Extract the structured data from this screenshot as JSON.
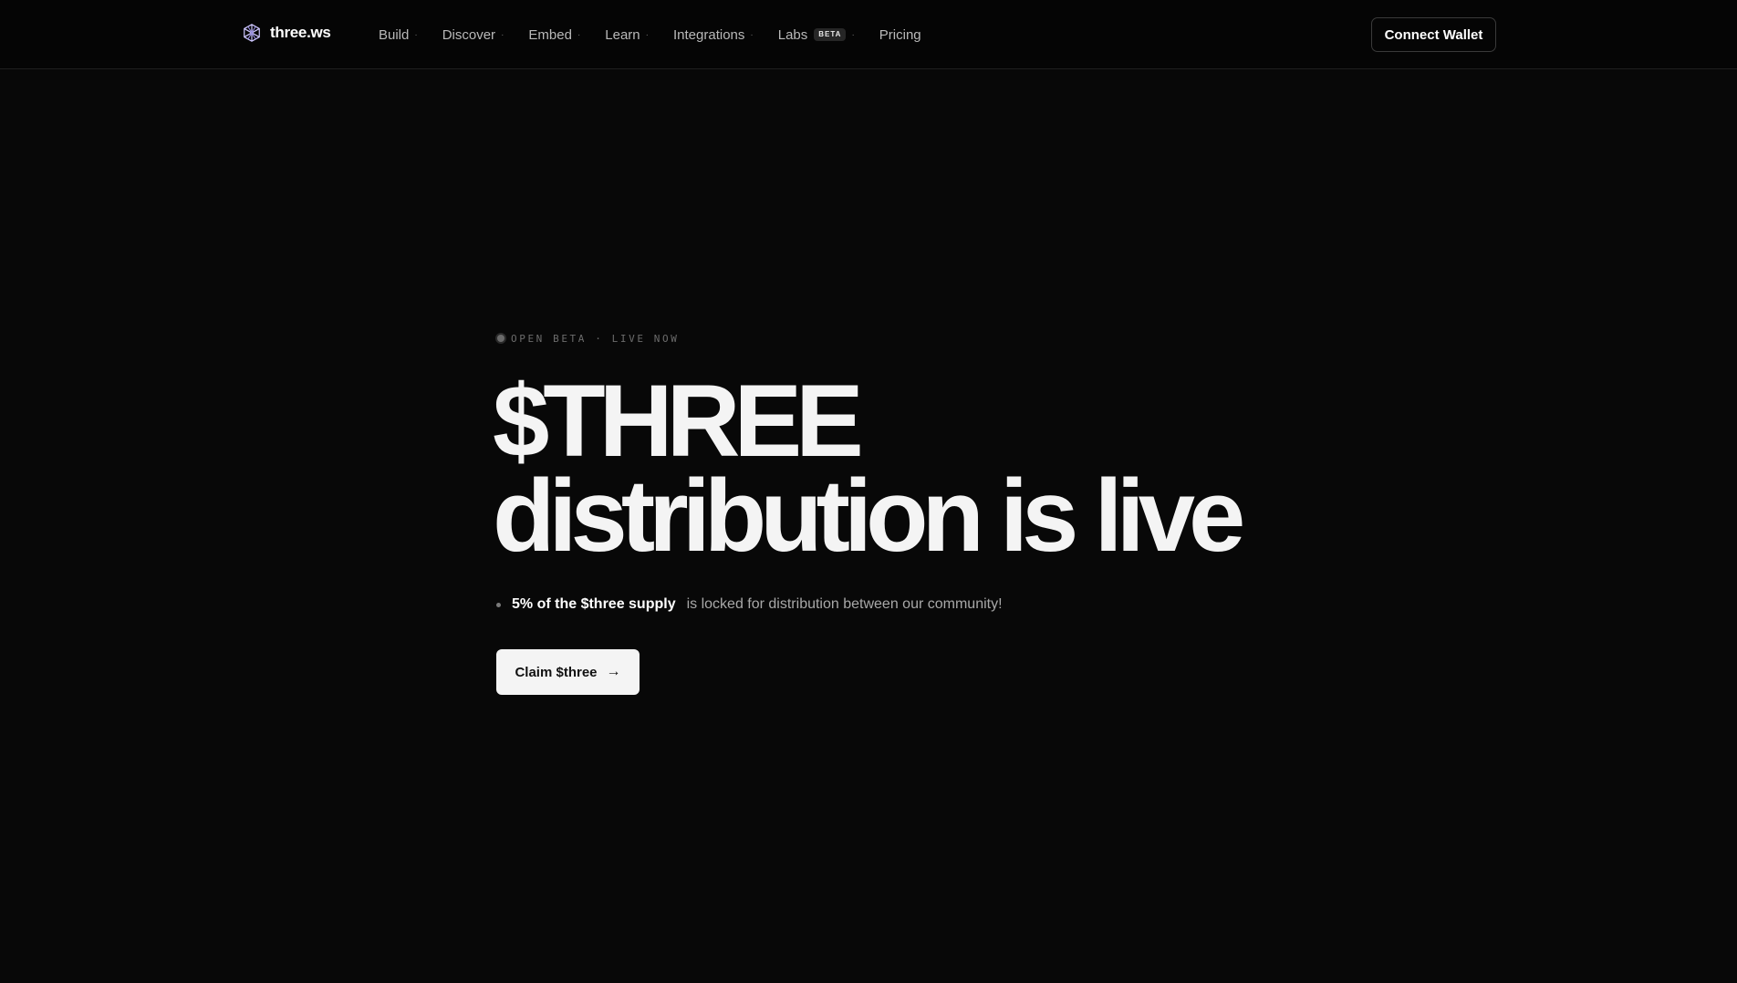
{
  "header": {
    "logo_text": "three.ws",
    "logo_icon": "cube-logo-icon",
    "nav": [
      {
        "label": "Build",
        "has_dropdown": true
      },
      {
        "label": "Discover",
        "has_dropdown": true
      },
      {
        "label": "Embed",
        "has_dropdown": true
      },
      {
        "label": "Learn",
        "has_dropdown": true
      },
      {
        "label": "Integrations",
        "has_dropdown": true
      },
      {
        "label": "Labs",
        "badge": "BETA",
        "has_dropdown": true
      },
      {
        "label": "Pricing",
        "has_dropdown": false
      }
    ],
    "dropdown_glyph": "·",
    "connect_wallet_label": "Connect Wallet"
  },
  "hero": {
    "status_text": "OPEN BETA · LIVE NOW",
    "headline_line1": "$THREE",
    "headline_line2": "distribution is live",
    "supply_strong": "5% of the $three supply",
    "supply_rest": "is locked for distribution between our community!",
    "claim_label": "Claim $three",
    "claim_arrow": "→"
  },
  "colors": {
    "background": "#080808",
    "text": "#f4f4f4",
    "muted": "#a8a8a8",
    "button_bg": "#f4f4f4"
  }
}
